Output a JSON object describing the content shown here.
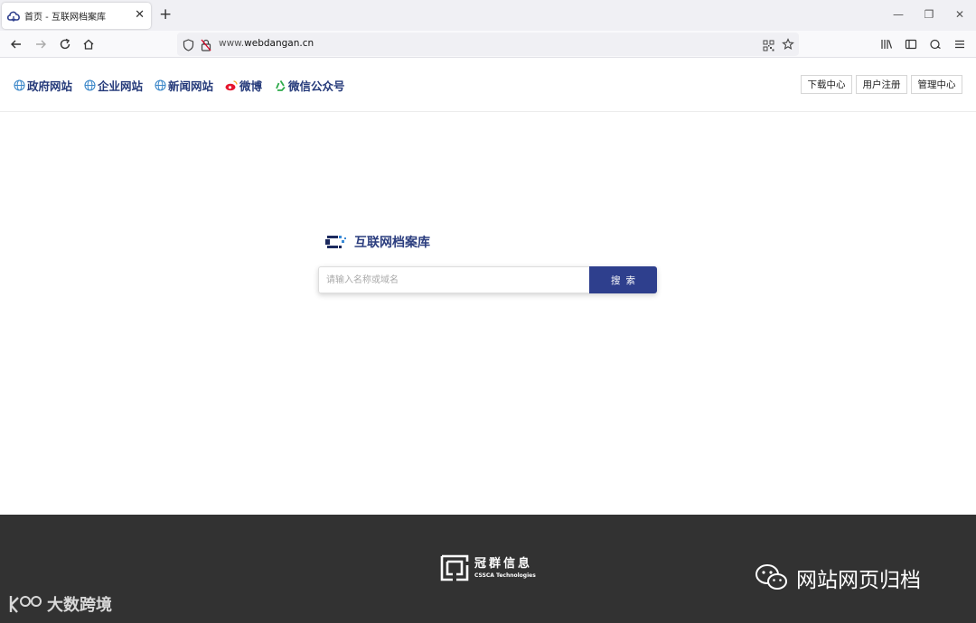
{
  "browser": {
    "tab": {
      "title": "首页 - 互联网档案库",
      "close": "✕"
    },
    "new_tab": "+",
    "window": {
      "minimize": "—",
      "restore": "❐",
      "close": "✕"
    },
    "url": {
      "prefix": "www.",
      "domain": "webdangan.cn"
    }
  },
  "site": {
    "nav": [
      {
        "label": "政府网站",
        "icon": "globe-icon"
      },
      {
        "label": "企业网站",
        "icon": "globe-icon"
      },
      {
        "label": "新闻网站",
        "icon": "globe-icon"
      },
      {
        "label": "微博",
        "icon": "weibo-icon"
      },
      {
        "label": "微信公众号",
        "icon": "recycle-icon"
      }
    ],
    "header_buttons": [
      "下载中心",
      "用户注册",
      "管理中心"
    ],
    "logo_text": "互联网档案库",
    "search": {
      "placeholder": "请输入名称或域名",
      "button": "搜索"
    }
  },
  "footer": {
    "company_cn": "冠群信息",
    "company_en": "CSSCA Technologies",
    "watermark_right": "网站网页归档",
    "watermark_left": "大数跨境"
  },
  "colors": {
    "brand": "#2e3f8d",
    "nav_text": "#253a7a",
    "footer_bg": "#323232"
  }
}
